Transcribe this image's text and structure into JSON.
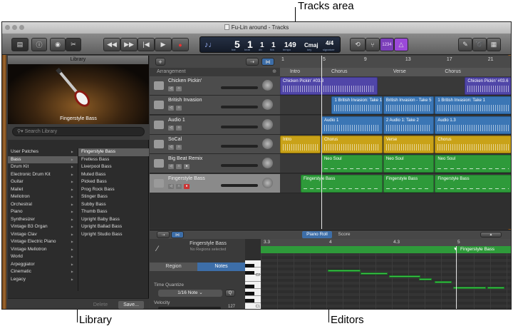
{
  "callouts": {
    "tracks_area": "Tracks area",
    "library": "Library",
    "editors": "Editors"
  },
  "window": {
    "title": "Fu-Lin around - Tracks"
  },
  "lcd": {
    "bar": "5",
    "beat": "1",
    "div": "1",
    "tick": "1",
    "tempo": "149",
    "key": "Cmaj",
    "sig": "4/4",
    "bar_label": "bar",
    "beat_label": "beat",
    "div_label": "div",
    "tick_label": "tick",
    "tempo_label": "tempo",
    "key_label": "key",
    "sig_label": "signature"
  },
  "toolbar": {
    "count_in": "1234"
  },
  "library": {
    "header": "Library",
    "caption": "Fingerstyle Bass",
    "search_placeholder": "Search Library",
    "categories": [
      "User Patches",
      "Bass",
      "Drum Kit",
      "Electronic Drum Kit",
      "Guitar",
      "Mallet",
      "Mellotron",
      "Orchestral",
      "Piano",
      "Synthesizer",
      "Vintage B3 Organ",
      "Vintage Clav",
      "Vintage Electric Piano",
      "Vintage Mellotron",
      "World",
      "Arpeggiator",
      "Cinematic",
      "Legacy"
    ],
    "selected_category": 1,
    "patches": [
      "Fingerstyle Bass",
      "Fretless Bass",
      "Liverpool Bass",
      "Muted Bass",
      "Picked Bass",
      "Prog Rock Bass",
      "Stinger Bass",
      "Subby Bass",
      "Thumb Bass",
      "Upright Baby Bass",
      "Upright Ballad Bass",
      "Upright Studio Bass"
    ],
    "selected_patch": 0,
    "delete_label": "Delete",
    "save_label": "Save..."
  },
  "tracks": {
    "arrangement_label": "Arrangement",
    "ruler": [
      "1",
      "5",
      "9",
      "13",
      "17",
      "21"
    ],
    "sections": [
      "Intro",
      "Chorus",
      "Verse",
      "Chorus"
    ],
    "list": [
      {
        "name": "Chicken Pickin'",
        "regions": [
          {
            "label": "Chicken Pickin' #03.3",
            "color": "purple",
            "start": 0,
            "end": 9.5
          },
          {
            "label": "Chicken Pickin' #03.6",
            "color": "purple",
            "start": 17.9,
            "end": 22.5
          }
        ]
      },
      {
        "name": "British Invasion",
        "regions": [
          {
            "label": "1  British Invasion: Take 1",
            "color": "blue",
            "start": 5,
            "end": 10
          },
          {
            "label": "British Invasion - Take 5",
            "color": "blue",
            "start": 10,
            "end": 15
          },
          {
            "label": "1  British Invasion: Take 1",
            "color": "blue",
            "start": 15,
            "end": 22.5
          }
        ]
      },
      {
        "name": "Audio 1",
        "regions": [
          {
            "label": "Audio 1",
            "color": "blue",
            "start": 4,
            "end": 10
          },
          {
            "label": "2  Audio 1: Take 2",
            "color": "blue",
            "start": 10,
            "end": 15
          },
          {
            "label": "Audio 1.3",
            "color": "blue",
            "start": 15,
            "end": 22.5
          }
        ]
      },
      {
        "name": "SoCal",
        "regions": [
          {
            "label": "Intro",
            "color": "yellow",
            "start": 0,
            "end": 4
          },
          {
            "label": "Chorus",
            "color": "yellow",
            "start": 4,
            "end": 10
          },
          {
            "label": "Verse",
            "color": "yellow",
            "start": 10,
            "end": 15
          },
          {
            "label": "Chorus",
            "color": "yellow",
            "start": 15,
            "end": 22.5
          }
        ]
      },
      {
        "name": "Big Beat Remix",
        "regions": [
          {
            "label": "Neo Soul",
            "color": "green",
            "start": 4,
            "end": 10
          },
          {
            "label": "Neo Soul",
            "color": "green",
            "start": 10,
            "end": 15
          },
          {
            "label": "Neo Soul",
            "color": "green",
            "start": 15,
            "end": 22.5
          }
        ]
      },
      {
        "name": "Fingerstyle Bass",
        "regions": [
          {
            "label": "Fingerstyle Bass",
            "color": "green",
            "start": 2,
            "end": 10
          },
          {
            "label": "Fingerstyle Bass",
            "color": "green",
            "start": 10,
            "end": 15
          },
          {
            "label": "Fingerstyle Bass",
            "color": "green",
            "start": 15,
            "end": 22.5
          }
        ]
      }
    ],
    "selected_track": 5,
    "playhead_bar": 5
  },
  "editors": {
    "tab_piano_roll": "Piano Roll",
    "tab_score": "Score",
    "track_name": "Fingerstyle Bass",
    "no_regions": "No Regions selected",
    "tab_region": "Region",
    "tab_notes": "Notes",
    "time_quantize_label": "Time Quantize",
    "quantize_value": "1/16 Note",
    "quantize_q": "Q",
    "velocity_label": "Velocity",
    "velocity_value": "127",
    "ruler": [
      "3.3",
      "4",
      "4.3",
      "5"
    ],
    "region_label": "Fingerstyle Bass",
    "key_c2": "C2",
    "key_c1": "C1"
  },
  "colors": {
    "selection_blue": "#3d6ea8",
    "green_region": "#2e9a3a",
    "purple_region": "#5046a8",
    "yellow_region": "#c9a218",
    "blue_region": "#3b76b5"
  }
}
